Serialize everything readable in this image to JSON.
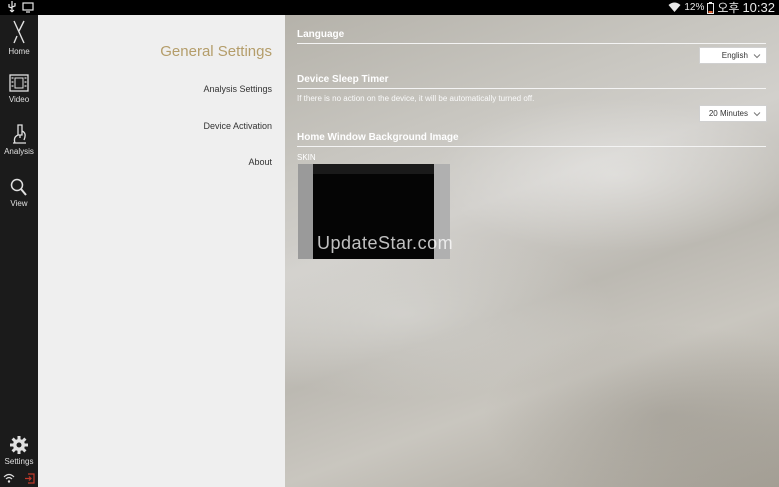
{
  "status_bar": {
    "battery_percent": "12%",
    "ampm": "오후",
    "time": "10:32",
    "icons": [
      "usb-icon",
      "screen-cast-icon",
      "wifi-icon",
      "battery-icon"
    ]
  },
  "rail": {
    "items": [
      {
        "label": "Home",
        "icon": "home-tool-icon"
      },
      {
        "label": "Video",
        "icon": "film-icon"
      },
      {
        "label": "Analysis",
        "icon": "microscope-icon"
      },
      {
        "label": "View",
        "icon": "search-icon"
      }
    ],
    "settings": {
      "label": "Settings",
      "icon": "gear-icon"
    }
  },
  "menu": {
    "title": "General Settings",
    "items": [
      "Analysis Settings",
      "Device Activation",
      "About"
    ]
  },
  "content": {
    "language": {
      "header": "Language",
      "value": "English"
    },
    "sleep": {
      "header": "Device Sleep Timer",
      "description": "If there is no action on the device, it will be automatically turned off.",
      "value": "20 Minutes"
    },
    "background": {
      "header": "Home Window Background Image",
      "skin_label": "SKIN"
    },
    "watermark": "UpdateStar.com"
  },
  "colors": {
    "accent_title": "#b49d6a",
    "rail_bg": "#1b1b1b",
    "menu_bg": "#efefef"
  }
}
